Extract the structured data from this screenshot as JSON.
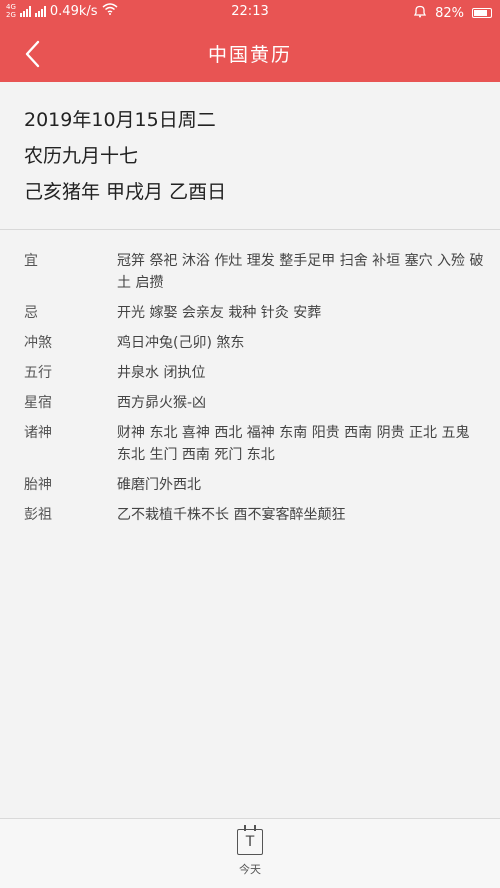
{
  "status_bar": {
    "net_top": "4G",
    "net_bottom": "2G",
    "speed": "0.49k/s",
    "time": "22:13",
    "battery": "82%",
    "battery_level": 0.82
  },
  "header": {
    "title": "中国黄历",
    "back_icon": "chevron-left-icon"
  },
  "date": {
    "gregorian": "2019年10月15日周二",
    "lunar": "农历九月十七",
    "ganzhi": "己亥猪年 甲戌月 乙酉日"
  },
  "rows": [
    {
      "label": "宜",
      "value": "冠笄 祭祀 沐浴 作灶 理发 整手足甲 扫舍 补垣 塞穴 入殓 破土 启攒"
    },
    {
      "label": "忌",
      "value": "开光 嫁娶 会亲友 栽种 针灸 安葬"
    },
    {
      "label": "冲煞",
      "value": "鸡日冲兔(己卯) 煞东"
    },
    {
      "label": "五行",
      "value": "井泉水 闭执位"
    },
    {
      "label": "星宿",
      "value": "西方昴火猴-凶"
    },
    {
      "label": "诸神",
      "value": "财神 东北 喜神 西北 福神 东南 阳贵 西南 阴贵 正北 五鬼 东北 生门 西南 死门 东北"
    },
    {
      "label": "胎神",
      "value": "碓磨门外西北"
    },
    {
      "label": "彭祖",
      "value": "乙不栽植千株不长 酉不宴客醉坐颠狂"
    }
  ],
  "bottom": {
    "today_icon_glyph": "T",
    "today_label": "今天"
  }
}
